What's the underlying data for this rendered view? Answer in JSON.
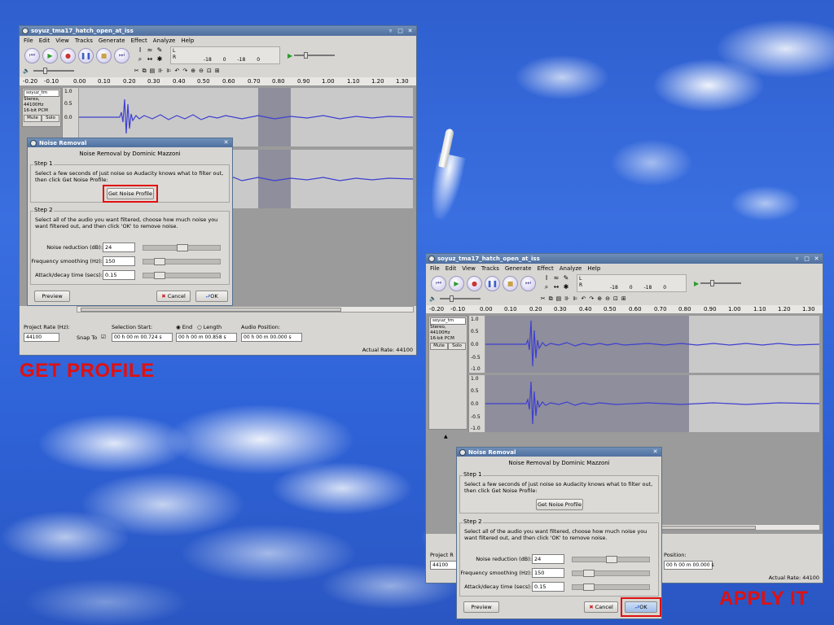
{
  "left_window": {
    "title": "soyuz_tma17_hatch_open_at_iss",
    "menu": [
      "File",
      "Edit",
      "View",
      "Tracks",
      "Generate",
      "Effect",
      "Analyze",
      "Help"
    ],
    "meter": {
      "l": "L",
      "r": "R",
      "ticks": [
        "-18",
        "0",
        "-18",
        "0"
      ]
    },
    "ruler": [
      "-0.20",
      "-0.10",
      "0.00",
      "0.10",
      "0.20",
      "0.30",
      "0.40",
      "0.50",
      "0.60",
      "0.70",
      "0.80",
      "0.90",
      "1.00",
      "1.10",
      "1.20",
      "1.30"
    ],
    "track": {
      "name": "soyuz_tm",
      "info1": "Stereo, 44100Hz",
      "info2": "16-bit PCM",
      "mute": "Mute",
      "solo": "Solo",
      "y_ticks": [
        "1.0",
        "0.5",
        "0.0"
      ]
    },
    "bottom": {
      "project_rate_label": "Project Rate (Hz):",
      "project_rate": "44100",
      "snap_to": "Snap To",
      "selection_start_label": "Selection Start:",
      "end_label": "End",
      "length_label": "Length",
      "audio_position_label": "Audio Position:",
      "selection_start": "00 h 00 m 00.724 s",
      "selection_end": "00 h 00 m 00.858 s",
      "audio_position": "00 h 00 m 00.000 s",
      "actual_rate": "Actual Rate: 44100"
    }
  },
  "right_window": {
    "title": "soyuz_tma17_hatch_open_at_iss",
    "menu": [
      "File",
      "Edit",
      "View",
      "Tracks",
      "Generate",
      "Effect",
      "Analyze",
      "Help"
    ],
    "meter": {
      "l": "L",
      "r": "R",
      "ticks": [
        "-18",
        "0",
        "-18",
        "0"
      ]
    },
    "ruler": [
      "-0.20",
      "-0.10",
      "0.00",
      "0.10",
      "0.20",
      "0.30",
      "0.40",
      "0.50",
      "0.60",
      "0.70",
      "0.80",
      "0.90",
      "1.00",
      "1.10",
      "1.20",
      "1.30"
    ],
    "track": {
      "name": "soyuz_tm",
      "info1": "Stereo, 44100Hz",
      "info2": "16-bit PCM",
      "mute": "Mute",
      "solo": "Solo",
      "y_ticks": [
        "1.0",
        "0.5",
        "0.0",
        "-0.5",
        "-1.0"
      ],
      "y_ticks2": [
        "1.0",
        "0.5",
        "0.0",
        "-0.5",
        "-1.0"
      ]
    },
    "bottom": {
      "project_rate_label": "Project R",
      "project_rate": "44100",
      "audio_position_label": "Position:",
      "audio_position": "00 h 00 m 00.000 s",
      "actual_rate": "Actual Rate: 44100"
    }
  },
  "dialog": {
    "title": "Noise Removal",
    "author": "Noise Removal by Dominic Mazzoni",
    "step1_title": "Step 1",
    "step1_text": "Select a few seconds of just noise so Audacity knows what to filter out, then click Get Noise Profile:",
    "get_profile": "Get Noise Profile",
    "step2_title": "Step 2",
    "step2_text": "Select all of the audio you want filtered, choose how much noise you want filtered out, and then click 'OK' to remove noise.",
    "params": [
      {
        "label": "Noise reduction (dB):",
        "value": "24",
        "level": 0.5
      },
      {
        "label": "Frequency smoothing (Hz):",
        "value": "150",
        "level": 0.15
      },
      {
        "label": "Attack/decay time (secs):",
        "value": "0.15",
        "level": 0.15
      }
    ],
    "preview": "Preview",
    "cancel": "Cancel",
    "ok": "OK"
  },
  "captions": {
    "left": "GET PROFILE",
    "right": "APPLY IT"
  }
}
